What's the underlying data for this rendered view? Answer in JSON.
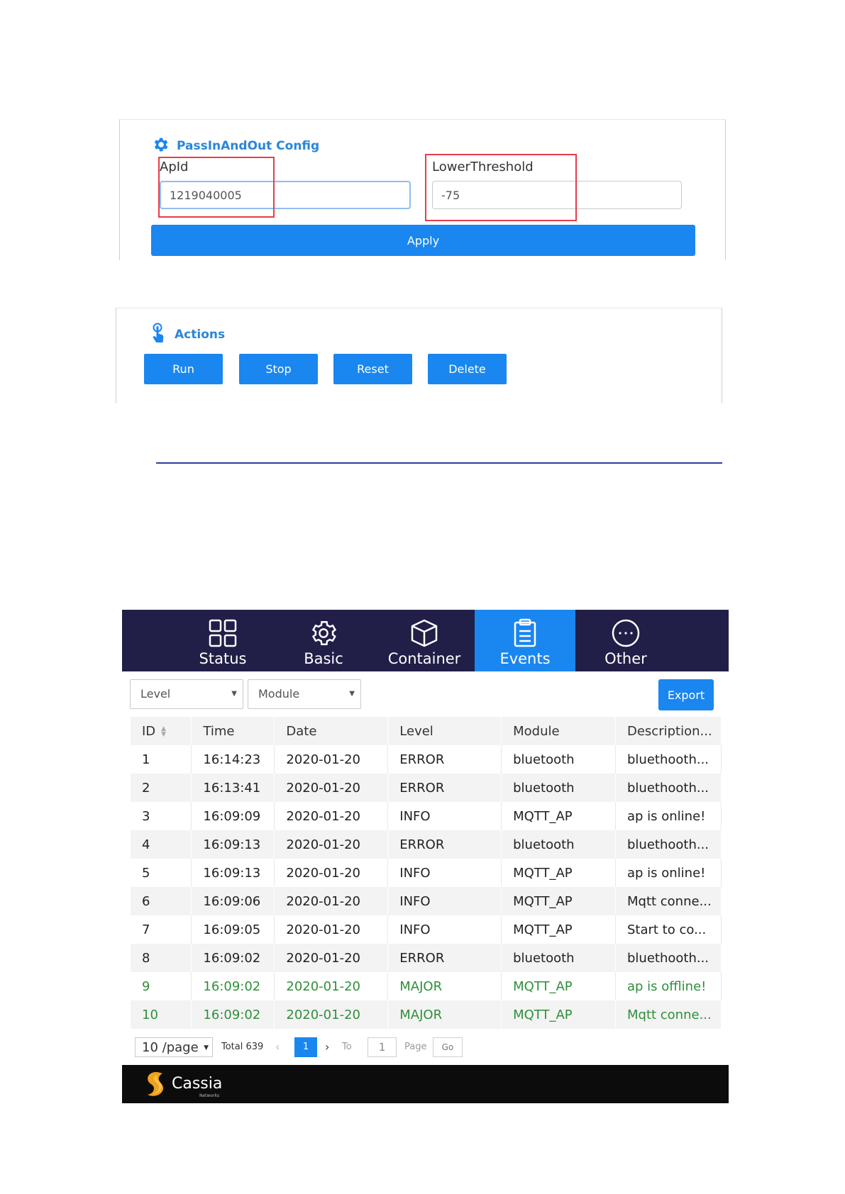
{
  "config": {
    "title": "PassInAndOut Config",
    "apid_label": "ApId",
    "apid_value": "1219040005",
    "lower_label": "LowerThreshold",
    "lower_value": "-75",
    "apply_label": "Apply"
  },
  "actions": {
    "title": "Actions",
    "buttons": [
      "Run",
      "Stop",
      "Reset",
      "Delete"
    ]
  },
  "nav": {
    "items": [
      "Status",
      "Basic",
      "Container",
      "Events",
      "Other"
    ],
    "active": "Events"
  },
  "filters": {
    "level": "Level",
    "module": "Module",
    "export_label": "Export"
  },
  "table": {
    "headers": [
      "ID",
      "Time",
      "Date",
      "Level",
      "Module",
      "Description..."
    ],
    "rows": [
      [
        "1",
        "16:14:23",
        "2020-01-20",
        "ERROR",
        "bluetooth",
        "bluethooth..."
      ],
      [
        "2",
        "16:13:41",
        "2020-01-20",
        "ERROR",
        "bluetooth",
        "bluethooth..."
      ],
      [
        "3",
        "16:09:09",
        "2020-01-20",
        "INFO",
        "MQTT_AP",
        "ap is online!"
      ],
      [
        "4",
        "16:09:13",
        "2020-01-20",
        "ERROR",
        "bluetooth",
        "bluethooth..."
      ],
      [
        "5",
        "16:09:13",
        "2020-01-20",
        "INFO",
        "MQTT_AP",
        "ap is online!"
      ],
      [
        "6",
        "16:09:06",
        "2020-01-20",
        "INFO",
        "MQTT_AP",
        "Mqtt conne..."
      ],
      [
        "7",
        "16:09:05",
        "2020-01-20",
        "INFO",
        "MQTT_AP",
        "Start to co..."
      ],
      [
        "8",
        "16:09:02",
        "2020-01-20",
        "ERROR",
        "bluetooth",
        "bluethooth..."
      ],
      [
        "9",
        "16:09:02",
        "2020-01-20",
        "MAJOR",
        "MQTT_AP",
        "ap is offline!"
      ],
      [
        "10",
        "16:09:02",
        "2020-01-20",
        "MAJOR",
        "MQTT_AP",
        "Mqtt conne..."
      ]
    ]
  },
  "pager": {
    "page_size": "10 /page",
    "total": "Total 639",
    "current_page": "1",
    "to_label": "To",
    "jump_value": "1",
    "page_label": "Page",
    "go_label": "Go"
  },
  "footer": {
    "logo_text": "Cassia",
    "logo_sub": "Networks"
  },
  "colors": {
    "accent": "#1a86f0",
    "nav_bg": "#211f48",
    "major_text": "#2f8f3a",
    "highlight_box": "#e53e4a"
  }
}
